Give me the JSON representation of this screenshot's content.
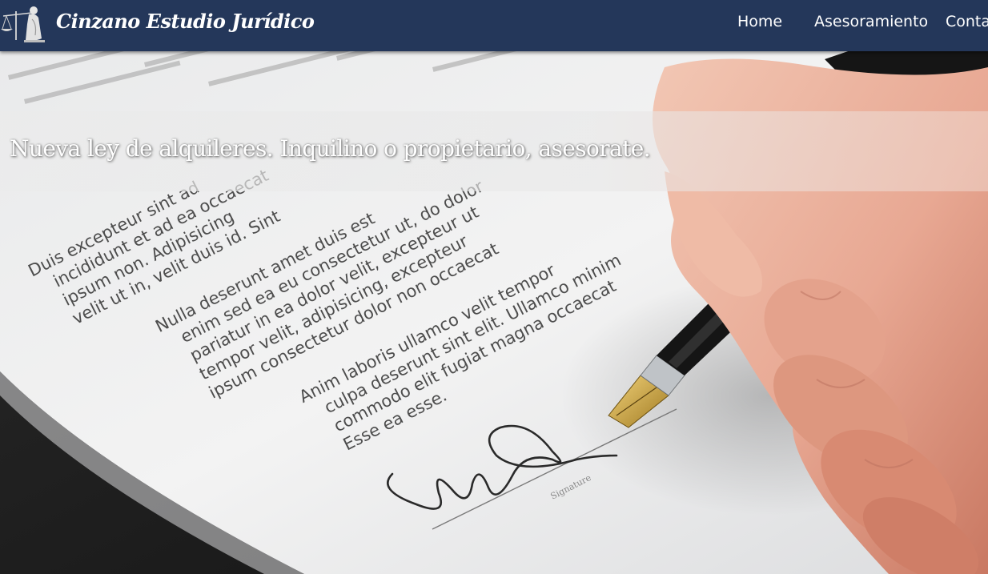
{
  "header": {
    "brand": "Cinzano Estudio Jurídico",
    "logo_icon": "scales-of-justice-icon",
    "nav": [
      {
        "label": "Home"
      },
      {
        "label": "Asesoramiento"
      },
      {
        "label": "Conta"
      }
    ]
  },
  "hero": {
    "headline": "Nueva ley de alquileres. Inquilino o propietario, asesorate.",
    "image": "document-signing-photo",
    "document": {
      "paragraphs": [
        [
          "Duis excepteur sint ad",
          "incididunt et ad ea occaecat",
          "ipsum non. Adipisicing",
          "velit ut in, velit duis id. Sint"
        ],
        [
          "Nulla deserunt amet duis est",
          "enim sed ea eu consectetur ut, do dolor",
          "pariatur in ea dolor velit, excepteur ut",
          "tempor velit, adipisicing, excepteur",
          "ipsum consectetur dolor non occaecat"
        ],
        [
          "Anim laboris ullamco velit tempor",
          "culpa deserunt sint elit. Ullamco minim",
          "commodo elit fugiat magna occaecat",
          "Esse ea esse."
        ]
      ],
      "signature_label": "Signature"
    }
  },
  "colors": {
    "navbar": "#24375a",
    "text_light": "#ffffff"
  }
}
